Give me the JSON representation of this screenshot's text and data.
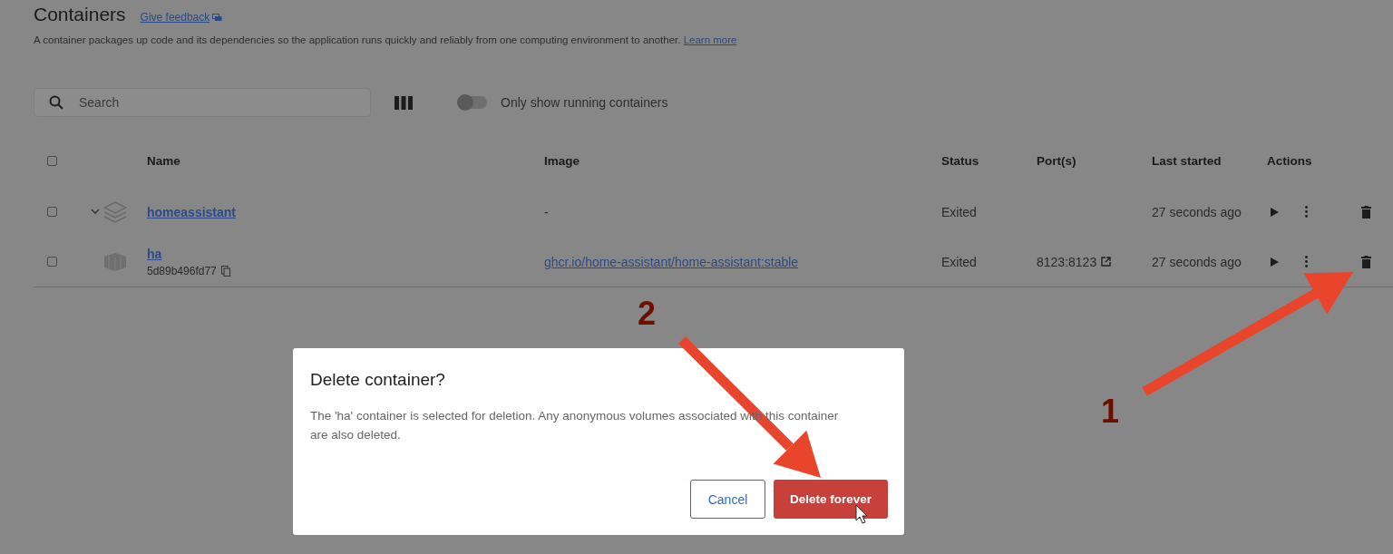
{
  "page": {
    "title": "Containers",
    "feedback_link": "Give feedback",
    "description": "A container packages up code and its dependencies so the application runs quickly and reliably from one computing environment to another.",
    "learn_more_link": "Learn more"
  },
  "toolbar": {
    "search": {
      "placeholder": "Search"
    },
    "running_toggle": {
      "label": "Only show running containers",
      "on": false
    }
  },
  "table": {
    "header_checkbox": {
      "checked": false
    },
    "columns": [
      "Name",
      "Image",
      "Status",
      "Port(s)",
      "Last started",
      "Actions"
    ],
    "rows": [
      {
        "kind": "group",
        "checked": false,
        "expanded": true,
        "name": "homeassistant",
        "image": "-",
        "status": "Exited",
        "last_started": "27 seconds ago"
      },
      {
        "kind": "container",
        "checked": false,
        "name": "ha",
        "container_id": "5d89b496fd77",
        "image": "ghcr.io/home-assistant/home-assistant:stable",
        "status": "Exited",
        "ports": "8123:8123",
        "last_started": "27 seconds ago"
      }
    ]
  },
  "modal": {
    "title": "Delete container?",
    "message": "The 'ha' container is selected for deletion. Any anonymous volumes associated with this container are also deleted.",
    "buttons": [
      {
        "label": "Cancel",
        "kind": "secondary"
      },
      {
        "label": "Delete forever",
        "kind": "danger"
      }
    ]
  },
  "annotations": [
    {
      "number": "1"
    },
    {
      "number": "2"
    }
  ]
}
